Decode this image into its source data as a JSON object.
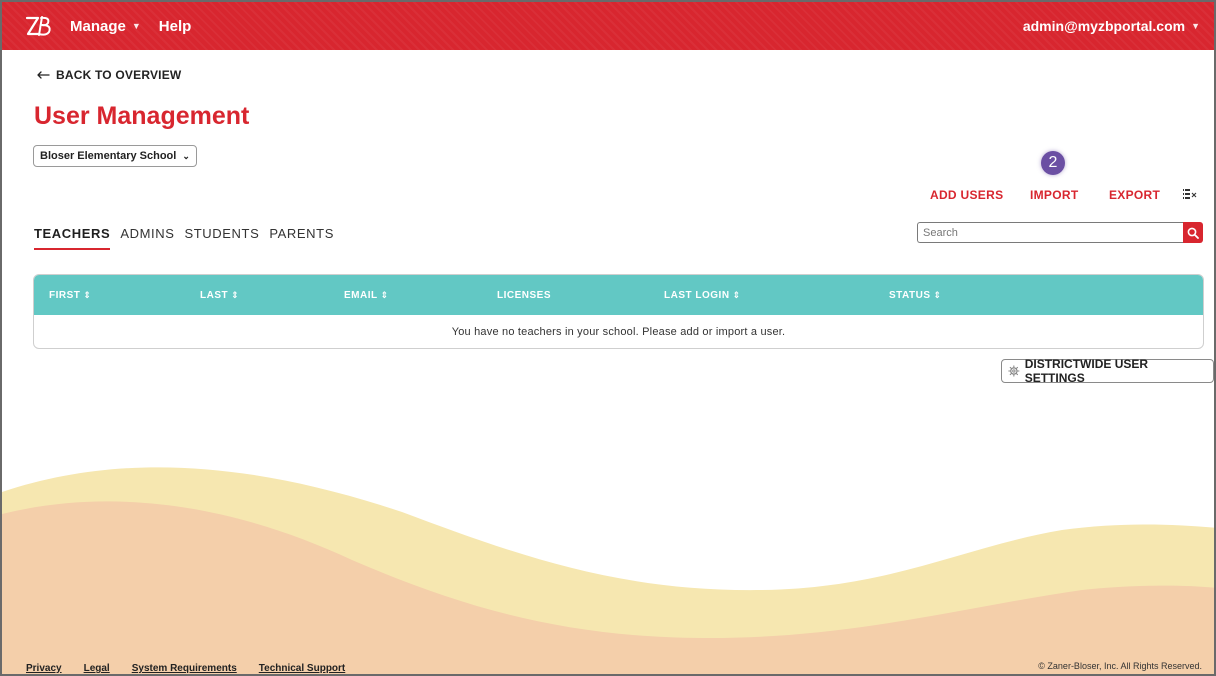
{
  "header": {
    "logo_text": "ZB",
    "nav": {
      "manage_label": "Manage",
      "help_label": "Help"
    },
    "account_label": "admin@myzbportal.com"
  },
  "back_link": {
    "label": "BACK TO OVERVIEW"
  },
  "page_title": "User Management",
  "school_select": {
    "value": "Bloser Elementary School"
  },
  "step_badge": "2",
  "actions": {
    "add_users": "ADD USERS",
    "import": "IMPORT",
    "export": "EXPORT"
  },
  "tabs": [
    {
      "label": "TEACHERS",
      "active": true
    },
    {
      "label": "ADMINS",
      "active": false
    },
    {
      "label": "STUDENTS",
      "active": false
    },
    {
      "label": "PARENTS",
      "active": false
    }
  ],
  "search": {
    "placeholder": "Search",
    "value": ""
  },
  "table": {
    "columns": [
      {
        "label": "FIRST",
        "sortable": true
      },
      {
        "label": "LAST",
        "sortable": true
      },
      {
        "label": "EMAIL",
        "sortable": true
      },
      {
        "label": "LICENSES",
        "sortable": false
      },
      {
        "label": "LAST LOGIN",
        "sortable": true
      },
      {
        "label": "STATUS",
        "sortable": true
      }
    ],
    "rows": [],
    "empty_message": "You have no teachers in your school. Please add or import a user."
  },
  "district_settings_button": "DISTRICTWIDE USER SETTINGS",
  "footer": {
    "links": [
      "Privacy",
      "Legal",
      "System Requirements",
      "Technical Support"
    ],
    "copyright": "© Zaner-Bloser, Inc. All Rights Reserved."
  },
  "colors": {
    "brand_red": "#d8262f",
    "table_header": "#62c8c4",
    "badge_purple": "#6b4fa3",
    "wave_yellow": "#f6e7b0",
    "wave_peach": "#f4cfaa"
  },
  "icons": {
    "logo": "zb-logo-icon",
    "back": "arrow-left-icon",
    "dropdown": "chevron-down-icon",
    "columns": "column-settings-icon",
    "search": "search-icon",
    "sort": "sort-icon",
    "gear": "gear-icon"
  }
}
